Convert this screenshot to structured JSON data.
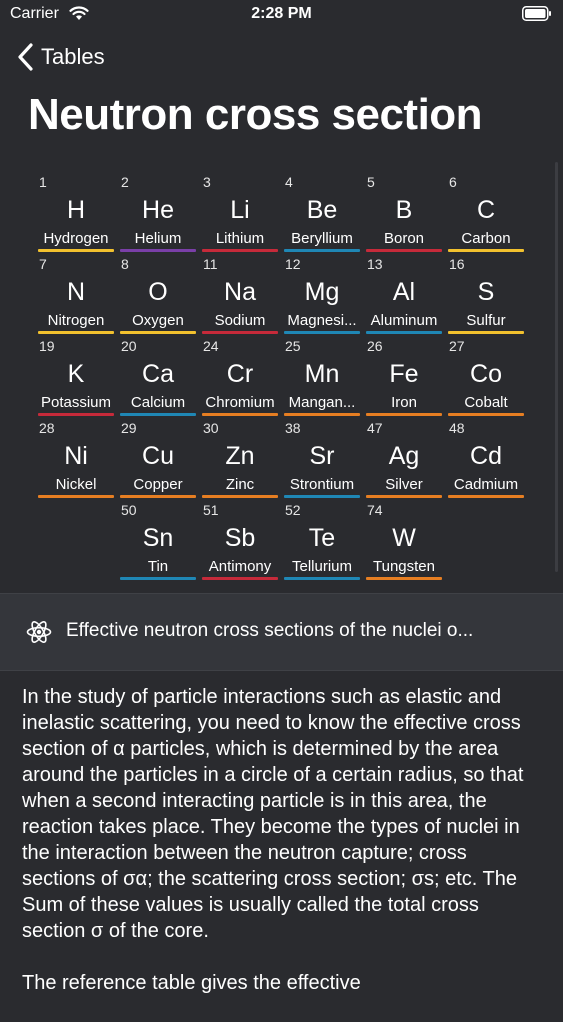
{
  "status": {
    "carrier": "Carrier",
    "time": "2:28 PM"
  },
  "nav": {
    "back_label": "Tables"
  },
  "title": "Neutron cross section",
  "elements": [
    {
      "num": "1",
      "symbol": "H",
      "name": "Hydrogen",
      "color": "#f2c12e"
    },
    {
      "num": "2",
      "symbol": "He",
      "name": "Helium",
      "color": "#7a3fa8"
    },
    {
      "num": "3",
      "symbol": "Li",
      "name": "Lithium",
      "color": "#c62a3a"
    },
    {
      "num": "4",
      "symbol": "Be",
      "name": "Beryllium",
      "color": "#1f87b5"
    },
    {
      "num": "5",
      "symbol": "B",
      "name": "Boron",
      "color": "#c62a3a"
    },
    {
      "num": "6",
      "symbol": "C",
      "name": "Carbon",
      "color": "#f2c12e"
    },
    {
      "num": "7",
      "symbol": "N",
      "name": "Nitrogen",
      "color": "#f2c12e"
    },
    {
      "num": "8",
      "symbol": "O",
      "name": "Oxygen",
      "color": "#f2c12e"
    },
    {
      "num": "11",
      "symbol": "Na",
      "name": "Sodium",
      "color": "#c62a3a"
    },
    {
      "num": "12",
      "symbol": "Mg",
      "name": "Magnesi...",
      "color": "#1f87b5"
    },
    {
      "num": "13",
      "symbol": "Al",
      "name": "Aluminum",
      "color": "#1f87b5"
    },
    {
      "num": "16",
      "symbol": "S",
      "name": "Sulfur",
      "color": "#f2c12e"
    },
    {
      "num": "19",
      "symbol": "K",
      "name": "Potassium",
      "color": "#c62a3a"
    },
    {
      "num": "20",
      "symbol": "Ca",
      "name": "Calcium",
      "color": "#1f87b5"
    },
    {
      "num": "24",
      "symbol": "Cr",
      "name": "Chromium",
      "color": "#e67e22"
    },
    {
      "num": "25",
      "symbol": "Mn",
      "name": "Mangan...",
      "color": "#e67e22"
    },
    {
      "num": "26",
      "symbol": "Fe",
      "name": "Iron",
      "color": "#e67e22"
    },
    {
      "num": "27",
      "symbol": "Co",
      "name": "Cobalt",
      "color": "#e67e22"
    },
    {
      "num": "28",
      "symbol": "Ni",
      "name": "Nickel",
      "color": "#e67e22"
    },
    {
      "num": "29",
      "symbol": "Cu",
      "name": "Copper",
      "color": "#e67e22"
    },
    {
      "num": "30",
      "symbol": "Zn",
      "name": "Zinc",
      "color": "#e67e22"
    },
    {
      "num": "38",
      "symbol": "Sr",
      "name": "Strontium",
      "color": "#1f87b5"
    },
    {
      "num": "47",
      "symbol": "Ag",
      "name": "Silver",
      "color": "#e67e22"
    },
    {
      "num": "48",
      "symbol": "Cd",
      "name": "Cadmium",
      "color": "#e67e22"
    },
    {
      "num": "50",
      "symbol": "Sn",
      "name": "Tin",
      "color": "#1f87b5"
    },
    {
      "num": "51",
      "symbol": "Sb",
      "name": "Antimony",
      "color": "#c62a3a"
    },
    {
      "num": "52",
      "symbol": "Te",
      "name": "Tellurium",
      "color": "#1f87b5"
    },
    {
      "num": "74",
      "symbol": "W",
      "name": "Tungsten",
      "color": "#e67e22"
    }
  ],
  "info": {
    "icon": "atom-icon",
    "text": "Effective neutron cross sections of the nuclei o..."
  },
  "body": {
    "paragraph1": "In the study of particle interactions such as elastic and inelastic scattering, you need to know the effective cross section of α particles, which is determined by the area around the particles in a circle of a certain radius, so that when a second interacting particle is in this area, the reaction takes place. They become the types of nuclei in the interaction between the neutron capture; cross sections of σα; the scattering cross section; σs; etc. The Sum of these values is usually called the total cross section σ of the core.",
    "paragraph2": "The reference table gives the effective"
  }
}
